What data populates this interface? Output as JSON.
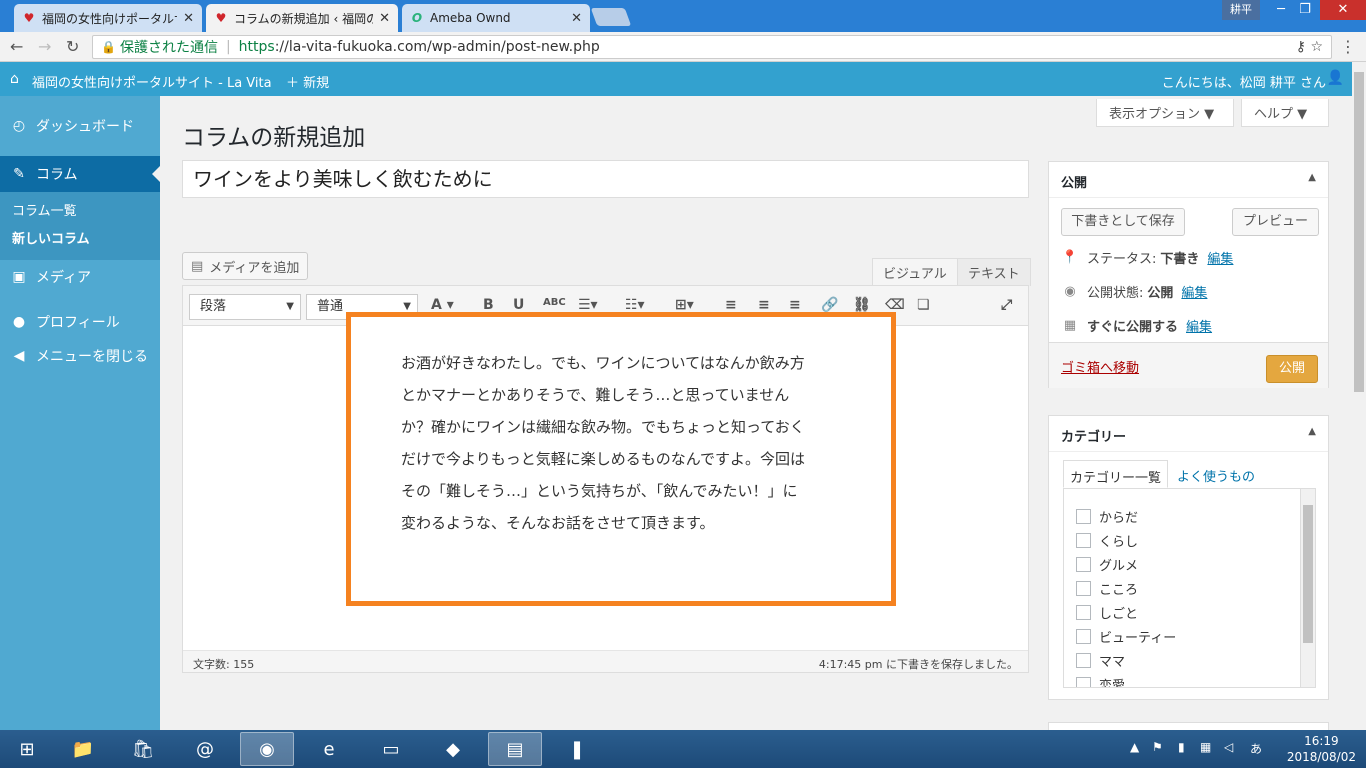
{
  "browser": {
    "tabs": [
      {
        "title": "福岡の女性向けポータルサイ",
        "favicon": "heart-icon"
      },
      {
        "title": "コラムの新規追加 ‹ 福岡の",
        "favicon": "heart-icon"
      },
      {
        "title": "Ameba Ownd",
        "favicon": "ameba-icon"
      }
    ],
    "window_user": "耕平",
    "secure_label": "保護された通信",
    "url_scheme": "https",
    "url_rest": "://la-vita-fukuoka.com/wp-admin/post-new.php"
  },
  "adminbar": {
    "site_name": "福岡の女性向けポータルサイト - La Vita",
    "new_label": "新規",
    "greeting": "こんにちは、松岡 耕平 さん"
  },
  "sidebar": {
    "dashboard": "ダッシュボード",
    "column": "コラム",
    "column_list": "コラム一覧",
    "new_column": "新しいコラム",
    "media": "メディア",
    "profile": "プロフィール",
    "collapse": "メニューを閉じる"
  },
  "screen_options": "表示オプション ▼",
  "help": "ヘルプ ▼",
  "page_title": "コラムの新規追加",
  "post_title": "ワインをより美味しく飲むために",
  "editor": {
    "add_media": "メディアを追加",
    "tab_visual": "ビジュアル",
    "tab_text": "テキスト",
    "format_select": "段落",
    "font_select": "普通",
    "body": "お酒が好きなわたし。でも、ワインについてはなんか飲み方とかマナーとかありそうで、難しそう…と思っていませんか？確かにワインは繊細な飲み物。でもちょっと知っておくだけで今よりもっと気軽に楽しめるものなんですよ。今回はその「難しそう…」という気持ちが、「飲んでみたい！」に変わるような、そんなお話をさせて頂きます。",
    "word_count": "文字数: 155",
    "saved_status": "4:17:45 pm に下書きを保存しました。"
  },
  "publish": {
    "heading": "公開",
    "save_draft": "下書きとして保存",
    "preview": "プレビュー",
    "status_label": "ステータス:",
    "status_value": "下書き",
    "visibility_label": "公開状態:",
    "visibility_value": "公開",
    "schedule_value": "すぐに公開する",
    "edit": "編集",
    "trash": "ゴミ箱へ移動",
    "publish_button": "公開"
  },
  "categories": {
    "heading": "カテゴリー",
    "tab_all": "カテゴリー一覧",
    "tab_popular": "よく使うもの",
    "items": [
      "からだ",
      "くらし",
      "グルメ",
      "こころ",
      "しごと",
      "ビューティー",
      "ママ",
      "恋愛"
    ]
  },
  "taskbar": {
    "time": "16:19",
    "date": "2018/08/02",
    "ime": "あ"
  },
  "colors": {
    "adminbar": "#33a1cf",
    "sidebar": "#50a9d1",
    "highlight": "#f58220",
    "publish": "#e4a73f"
  }
}
